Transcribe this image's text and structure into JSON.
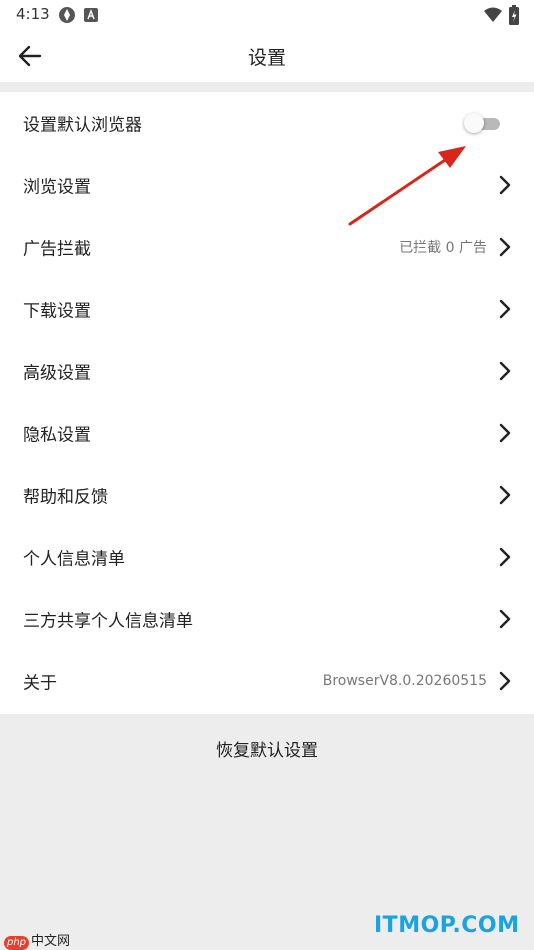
{
  "status_bar": {
    "time": "4:13",
    "icons": [
      "apps-icon",
      "accessibility-icon",
      "wifi-icon",
      "battery-charging-icon"
    ]
  },
  "app_bar": {
    "back_icon": "arrow-left-icon",
    "title": "设置"
  },
  "settings": {
    "default_browser": {
      "label": "设置默认浏览器",
      "enabled": false
    },
    "items": [
      {
        "label": "浏览设置",
        "value": ""
      },
      {
        "label": "广告拦截",
        "value": "已拦截 0 广告"
      },
      {
        "label": "下载设置",
        "value": ""
      },
      {
        "label": "高级设置",
        "value": ""
      },
      {
        "label": "隐私设置",
        "value": ""
      },
      {
        "label": "帮助和反馈",
        "value": ""
      },
      {
        "label": "个人信息清单",
        "value": ""
      },
      {
        "label": "三方共享个人信息清单",
        "value": ""
      },
      {
        "label": "关于",
        "value": "BrowserV8.0.20260515"
      }
    ]
  },
  "restore_defaults": "恢复默认设置",
  "watermarks": {
    "left_badge": "php",
    "left_text": "中文网",
    "right_text": "ITMOP.COM"
  },
  "colors": {
    "background": "#ededed",
    "surface": "#ffffff",
    "annotation_arrow": "#d9261c",
    "watermark_blue": "#1aa3e0"
  }
}
